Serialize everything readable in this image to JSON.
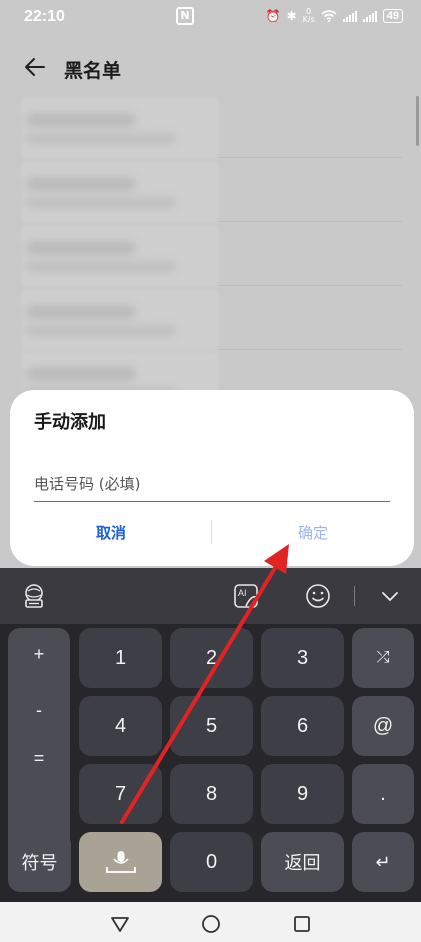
{
  "status_bar": {
    "time": "22:10",
    "nfc": "N",
    "speed_value": "0",
    "speed_unit": "K/s",
    "battery": "49"
  },
  "header": {
    "title": "黑名单"
  },
  "dialog": {
    "title": "手动添加",
    "phone_placeholder": "电话号码 (必填)",
    "phone_value": "",
    "cancel_label": "取消",
    "confirm_label": "确定"
  },
  "keyboard": {
    "side_keys": [
      "+",
      "-",
      "=",
      "/"
    ],
    "digit_rows": [
      [
        "1",
        "2",
        "3"
      ],
      [
        "4",
        "5",
        "6"
      ],
      [
        "7",
        "8",
        "9"
      ]
    ],
    "right_keys": [
      "⤮",
      "@",
      "."
    ],
    "bottom": {
      "symbols_label": "符号",
      "zero_label": "0",
      "return_label": "返回",
      "enter_glyph": "↵"
    }
  },
  "colors": {
    "accent_blue": "#1f5fd6",
    "confirm_disabled": "#9ab5ea",
    "annotation_arrow": "#e02424",
    "keyboard_bg": "#26262b"
  }
}
